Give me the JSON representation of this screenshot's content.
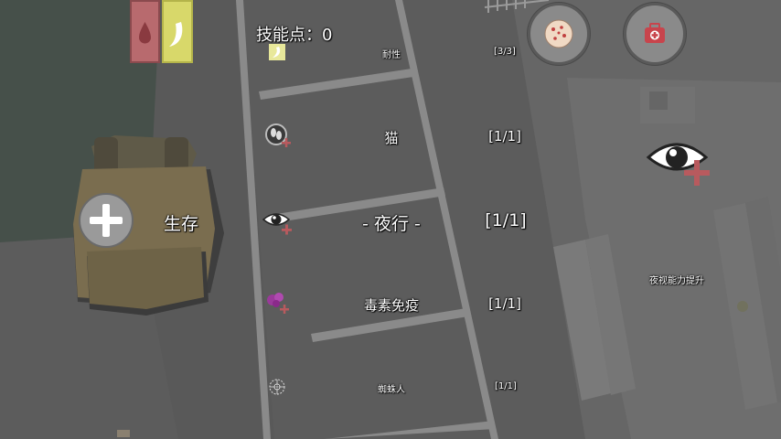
{
  "hud": {
    "skill_points_label": "技能点：0",
    "category_label": "生存",
    "skill_description": "夜视能力提升"
  },
  "stats": {
    "water_color": "#b86a6e",
    "food_color": "#d8d86a"
  },
  "skills": [
    {
      "name": "耐性",
      "level": "[3/3]",
      "icon": "banana-icon"
    },
    {
      "name": "猫",
      "level": "[1/1]",
      "icon": "cat-eye-icon"
    },
    {
      "name": "- 夜行 -",
      "level": "[1/1]",
      "icon": "night-eye-icon",
      "selected": true
    },
    {
      "name": "毒素免疫",
      "level": "[1/1]",
      "icon": "poison-icon"
    },
    {
      "name": "蜘蛛人",
      "level": "[1/1]",
      "icon": "spider-icon"
    }
  ],
  "buttons": {
    "cookie": "cookie-icon",
    "medkit": "medkit-icon",
    "add": "plus-icon"
  }
}
